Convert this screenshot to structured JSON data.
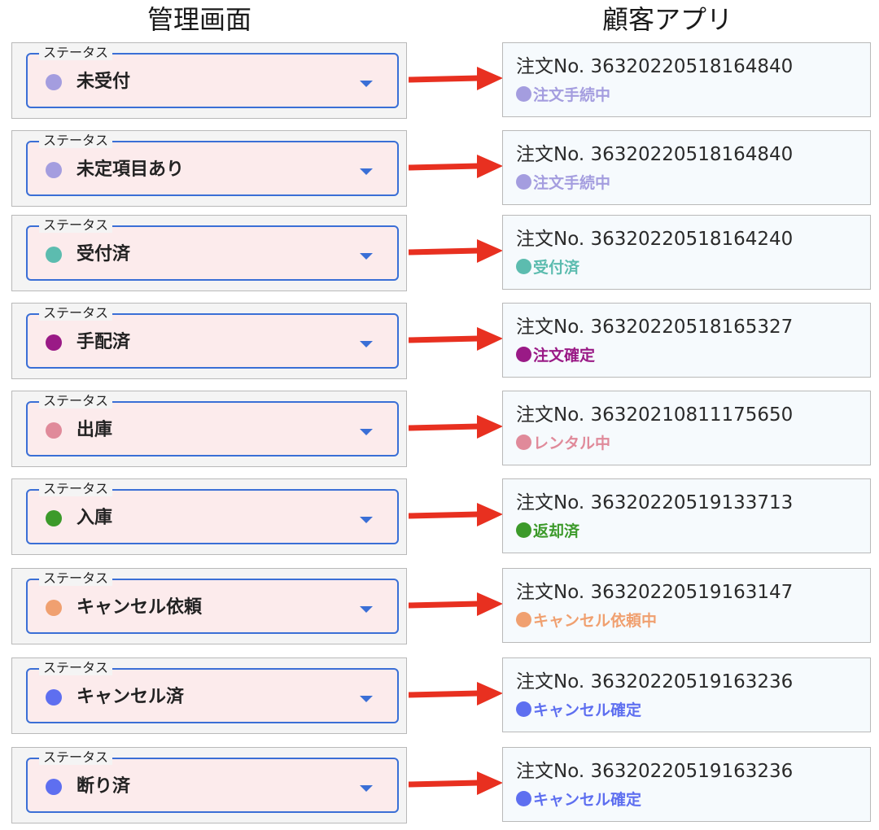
{
  "headers": {
    "admin": "管理画面",
    "customer": "顧客アプリ"
  },
  "field_label": "ステータス",
  "rows": [
    {
      "admin_status": "未受付",
      "admin_color": "#a49ddf",
      "order_no": "注文No. 36320220518164840",
      "customer_status": "注文手続中",
      "customer_color": "#a49ddf"
    },
    {
      "admin_status": "未定項目あり",
      "admin_color": "#a49ddf",
      "order_no": "注文No. 36320220518164840",
      "customer_status": "注文手続中",
      "customer_color": "#a49ddf"
    },
    {
      "admin_status": "受付済",
      "admin_color": "#5cbcaf",
      "order_no": "注文No. 36320220518164240",
      "customer_status": "受付済",
      "customer_color": "#5cbcaf"
    },
    {
      "admin_status": "手配済",
      "admin_color": "#9a1a86",
      "order_no": "注文No. 36320220518165327",
      "customer_status": "注文確定",
      "customer_color": "#9a1a86"
    },
    {
      "admin_status": "出庫",
      "admin_color": "#e08a9a",
      "order_no": "注文No. 36320210811175650",
      "customer_status": "レンタル中",
      "customer_color": "#e08a9a"
    },
    {
      "admin_status": "入庫",
      "admin_color": "#3c9a2a",
      "order_no": "注文No. 36320220519133713",
      "customer_status": "返却済",
      "customer_color": "#3c9a2a"
    },
    {
      "admin_status": "キャンセル依頼",
      "admin_color": "#f0a070",
      "order_no": "注文No. 36320220519163147",
      "customer_status": "キャンセル依頼中",
      "customer_color": "#f0a070"
    },
    {
      "admin_status": "キャンセル済",
      "admin_color": "#5e6ff0",
      "order_no": "注文No. 36320220519163236",
      "customer_status": "キャンセル確定",
      "customer_color": "#5e6ff0"
    },
    {
      "admin_status": "断り済",
      "admin_color": "#5e6ff0",
      "order_no": "注文No. 36320220519163236",
      "customer_status": "キャンセル確定",
      "customer_color": "#5e6ff0"
    }
  ],
  "arrow_color": "#e83020"
}
